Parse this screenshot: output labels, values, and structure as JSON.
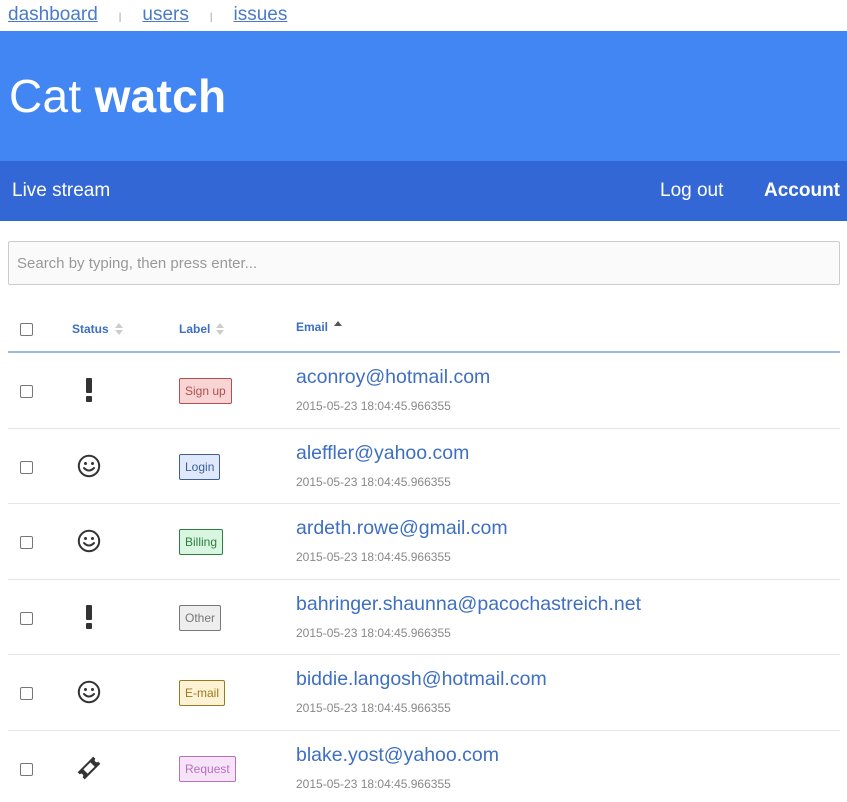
{
  "top_links": [
    "dashboard",
    "users",
    "issues"
  ],
  "top_sep": "|",
  "header": {
    "title_light": "Cat",
    "title_bold": "watch"
  },
  "nav": {
    "live": "Live stream",
    "logout": "Log out",
    "account": "Account"
  },
  "search": {
    "placeholder": "Search by typing, then press enter..."
  },
  "table": {
    "columns": {
      "status": "Status",
      "label": "Label",
      "email": "Email"
    },
    "sorted_column": "email",
    "sort_direction": "ascending",
    "rows": [
      {
        "status": "exclamation-icon",
        "label": "Sign up",
        "label_style": "b-signup",
        "email": "aconroy@hotmail.com",
        "time": "2015-05-23 18:04:45.966355"
      },
      {
        "status": "smiley-icon",
        "label": "Login",
        "label_style": "b-login",
        "email": "aleffler@yahoo.com",
        "time": "2015-05-23 18:04:45.966355"
      },
      {
        "status": "smiley-icon",
        "label": "Billing",
        "label_style": "b-billing",
        "email": "ardeth.rowe@gmail.com",
        "time": "2015-05-23 18:04:45.966355"
      },
      {
        "status": "exclamation-icon",
        "label": "Other",
        "label_style": "b-other",
        "email": "bahringer.shaunna@pacochastreich.net",
        "time": "2015-05-23 18:04:45.966355"
      },
      {
        "status": "smiley-icon",
        "label": "E-mail",
        "label_style": "b-email",
        "email": "biddie.langosh@hotmail.com",
        "time": "2015-05-23 18:04:45.966355"
      },
      {
        "status": "ticket-icon",
        "label": "Request",
        "label_style": "b-request",
        "email": "blake.yost@yahoo.com",
        "time": "2015-05-23 18:04:45.966355"
      }
    ]
  },
  "colors": {
    "header": "#4286f4",
    "nav": "#3367d6",
    "link": "#3e6fc1"
  }
}
